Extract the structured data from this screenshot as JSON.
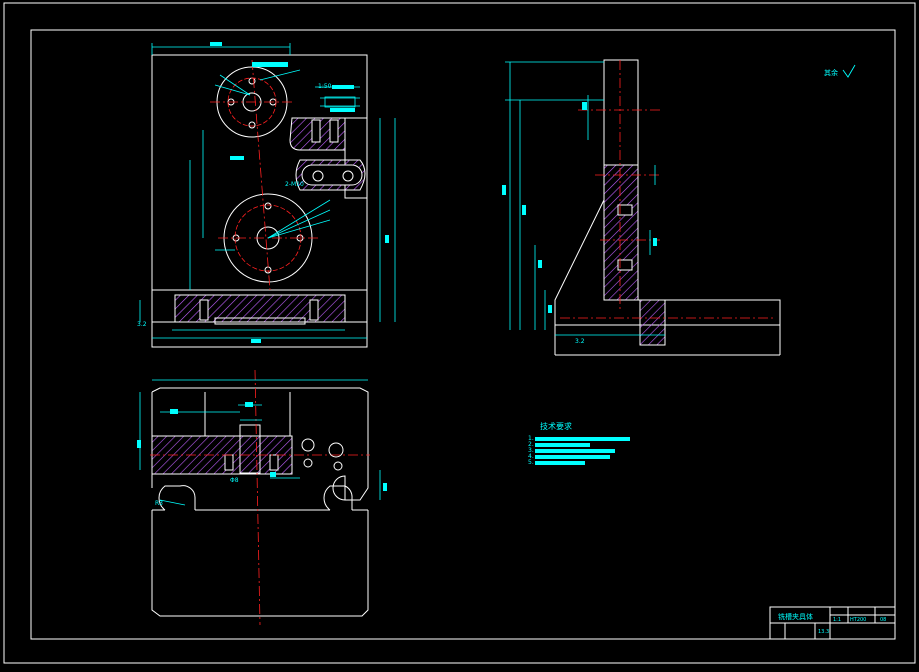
{
  "drawing": {
    "colors": {
      "background": "#000000",
      "frame": "#ffffff",
      "outline": "#ffffff",
      "dimension": "#00ffff",
      "centerline": "#ff2020",
      "hatch": "#c060ff",
      "hidden": "#ffff00"
    },
    "views": {
      "front": {
        "dims": [
          "1:50",
          "2-M10"
        ],
        "surface_mark": "3.2"
      },
      "side": {
        "roughness_note": "其余",
        "surface_mark": "3.2"
      },
      "top": {
        "dims": [
          "Φ8",
          "R3"
        ]
      }
    },
    "tech_requirements": {
      "heading": "技术要求",
      "items": [
        "1.",
        "2.",
        "3.",
        "4.",
        "5."
      ]
    },
    "title_block": {
      "name": "铣槽夹具体",
      "scale": "1:1",
      "material": "HT200",
      "sheet": "08",
      "weight": "13.3"
    }
  }
}
